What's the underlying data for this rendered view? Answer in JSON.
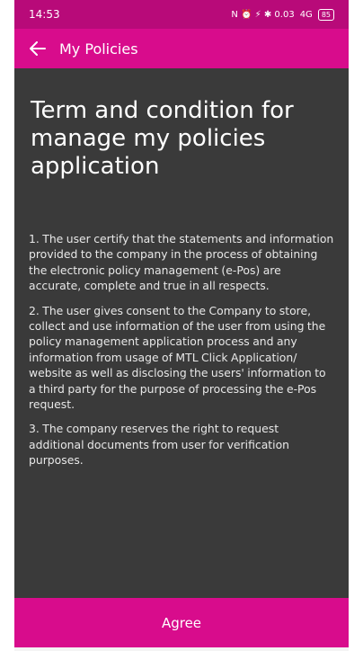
{
  "status_bar": {
    "time": "14:53",
    "icons_text": "N ⏰ ⚡ ✱ 0.03",
    "battery_label": "85",
    "signal_label": "4G"
  },
  "app_bar": {
    "title": "My Policies",
    "back_icon": "arrow-left-icon"
  },
  "content": {
    "heading": "Term and condition for manage my policies application",
    "paragraphs": [
      "1. The user certify that the statements and information provided to the company in the process of obtaining the electronic policy management (e-Pos) are accurate, complete and true in all respects.",
      "2. The user gives consent to the Company to store, collect and use information of the user from using the policy management application process and any information from usage of MTL Click Application/ website as well as disclosing the users' information to a third party for the purpose of processing the e-Pos request.",
      "3. The company reserves the right to request additional documents from user for verification purposes."
    ]
  },
  "footer": {
    "agree_label": "Agree"
  },
  "colors": {
    "status_bar": "#b80a79",
    "app_bar": "#d80c8c",
    "background": "#3a3a3a",
    "text": "#ffffff"
  }
}
